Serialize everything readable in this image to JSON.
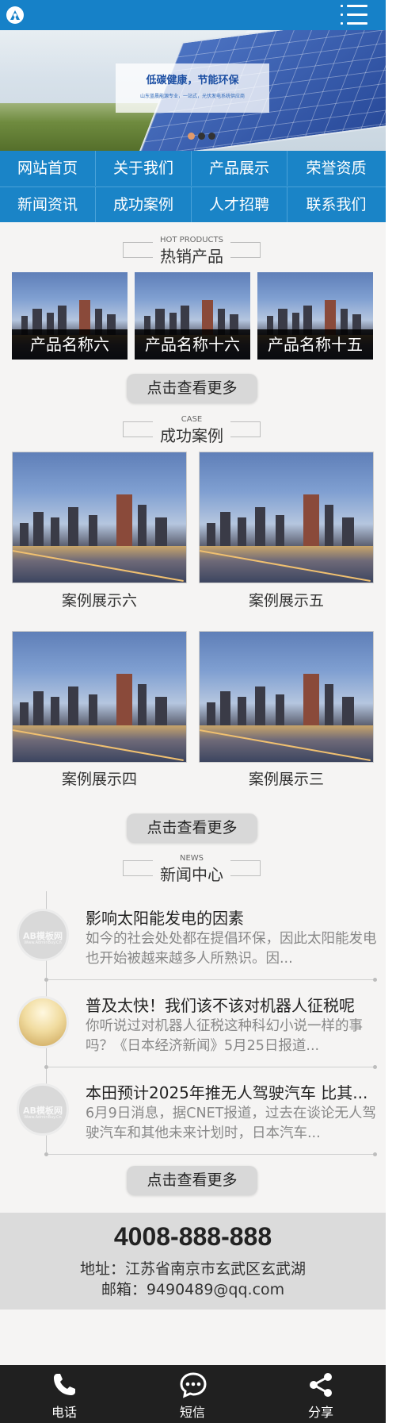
{
  "header": {
    "logo_icon": "logo-icon",
    "menu_icon": "menu-icon"
  },
  "banner": {
    "title": "低碳健康，节能环保",
    "subtitle": "山东蓝晨能源专业，一站式，光伏发电系统供应商",
    "dots": 3,
    "active_dot": 0
  },
  "nav": {
    "items": [
      {
        "label": "网站首页"
      },
      {
        "label": "关于我们"
      },
      {
        "label": "产品展示"
      },
      {
        "label": "荣誉资质"
      },
      {
        "label": "新闻资讯"
      },
      {
        "label": "成功案例"
      },
      {
        "label": "人才招聘"
      },
      {
        "label": "联系我们"
      }
    ]
  },
  "products": {
    "title_en": "HOT PRODUCTS",
    "title_cn": "热销产品",
    "items": [
      {
        "name": "产品名称六"
      },
      {
        "name": "产品名称十六"
      },
      {
        "name": "产品名称十五"
      }
    ],
    "more": "点击查看更多"
  },
  "cases": {
    "title_en": "CASE",
    "title_cn": "成功案例",
    "items": [
      {
        "name": "案例展示六"
      },
      {
        "name": "案例展示五"
      },
      {
        "name": "案例展示四"
      },
      {
        "name": "案例展示三"
      }
    ],
    "more": "点击查看更多"
  },
  "news": {
    "title_en": "NEWS",
    "title_cn": "新闻中心",
    "items": [
      {
        "title": "影响太阳能发电的因素",
        "desc": "如今的社会处处都在提倡环保，因此太阳能发电也开始被越来越多人所熟识。因...",
        "thumb": "AB模板网",
        "thumb_sub": "Www.AdminBuy.Cn"
      },
      {
        "title": "普及太快！我们该不该对机器人征税呢",
        "desc": "你听说过对机器人征税这种科幻小说一样的事吗？《日本经济新闻》5月25日报道...",
        "thumb": "",
        "thumb_sub": ""
      },
      {
        "title": "本田预计2025年推无人驾驶汽车 比其...",
        "desc": "6月9日消息，据CNET报道，过去在谈论无人驾驶汽车和其他未来计划时，日本汽车...",
        "thumb": "AB模板网",
        "thumb_sub": "Www.AdminBuy.Cn"
      }
    ],
    "more": "点击查看更多"
  },
  "contact": {
    "phone": "4008-888-888",
    "address": "地址：江苏省南京市玄武区玄武湖",
    "email": "邮箱：9490489@qq.com"
  },
  "bottom_bar": {
    "items": [
      {
        "label": "电话",
        "icon": "phone-icon"
      },
      {
        "label": "短信",
        "icon": "message-icon"
      },
      {
        "label": "分享",
        "icon": "share-icon"
      }
    ]
  },
  "colors": {
    "primary": "#1681c8",
    "nav": "#1a84c7",
    "bottom_bar": "#202020"
  }
}
